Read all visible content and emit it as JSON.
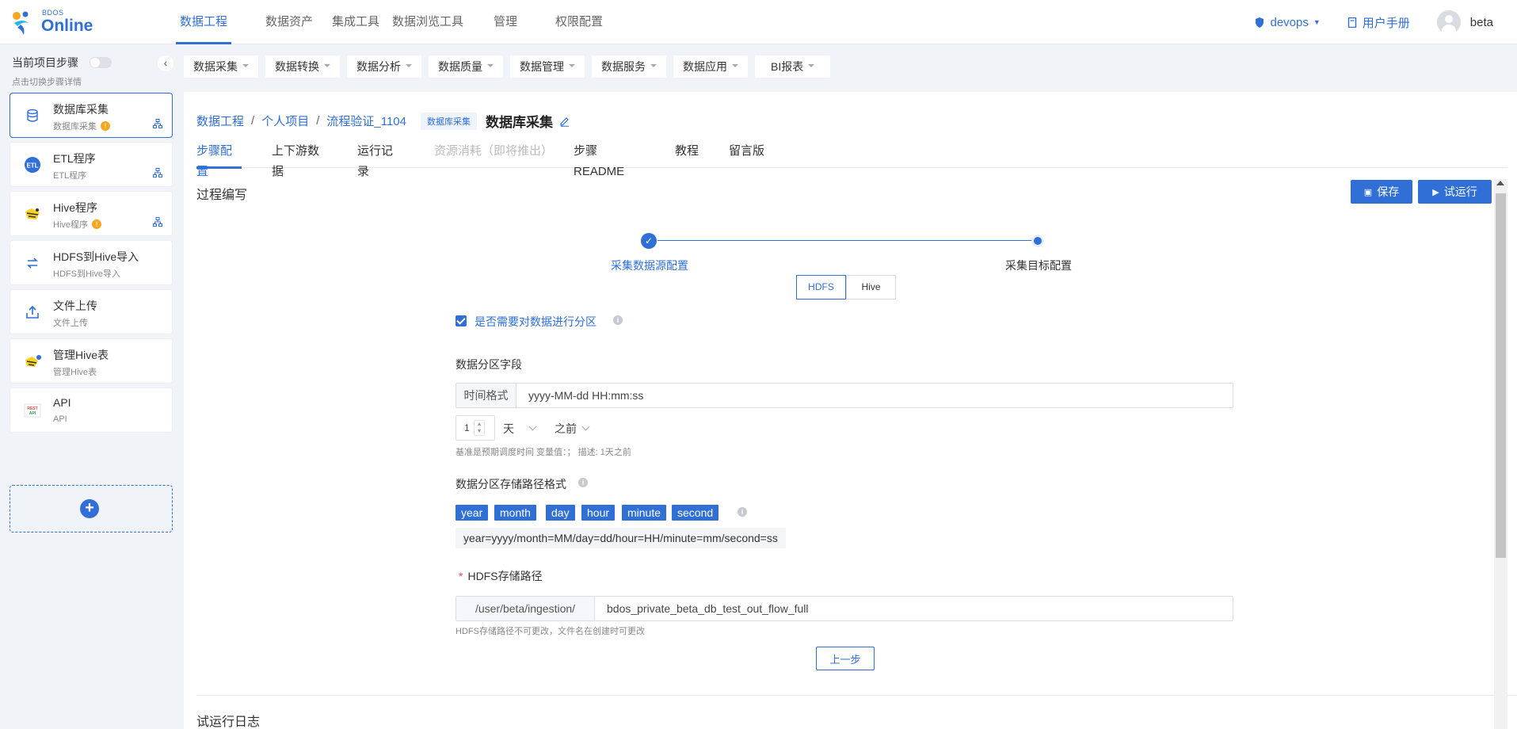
{
  "logo": {
    "small": "BDOS",
    "big": "Online"
  },
  "nav": [
    {
      "label": "数据工程",
      "active": true
    },
    {
      "label": "数据资产"
    },
    {
      "label": "集成工具"
    },
    {
      "label": "数据浏览工具"
    },
    {
      "label": "管理"
    },
    {
      "label": "权限配置"
    }
  ],
  "top_right": {
    "project": "devops",
    "manual": "用户手册",
    "user": "beta"
  },
  "sidebar": {
    "header": "当前项目步骤",
    "subheader": "点击切换步骤详情",
    "collapse_glyph": "‹",
    "items": [
      {
        "title": "数据库采集",
        "sub": "数据库采集",
        "warn": true,
        "tree": true,
        "icon": "database-icon"
      },
      {
        "title": "ETL程序",
        "sub": "ETL程序",
        "warn": false,
        "tree": true,
        "icon": "etl-icon"
      },
      {
        "title": "Hive程序",
        "sub": "Hive程序",
        "warn": true,
        "tree": true,
        "icon": "hive-icon"
      },
      {
        "title": "HDFS到Hive导入",
        "sub": "HDFS到Hive导入",
        "warn": false,
        "tree": false,
        "icon": "transfer-icon"
      },
      {
        "title": "文件上传",
        "sub": "文件上传",
        "warn": false,
        "tree": false,
        "icon": "upload-icon"
      },
      {
        "title": "管理Hive表",
        "sub": "管理Hive表",
        "warn": false,
        "tree": false,
        "icon": "hive-table-icon"
      },
      {
        "title": "API",
        "sub": "API",
        "warn": false,
        "tree": false,
        "icon": "rest-api-icon"
      }
    ],
    "add_glyph": "+"
  },
  "categories": [
    "数据采集",
    "数据转换",
    "数据分析",
    "数据质量",
    "数据管理",
    "数据服务",
    "数据应用",
    "BI报表"
  ],
  "breadcrumb": {
    "items": [
      "数据工程",
      "个人项目",
      "流程验证_1104"
    ],
    "sep": "/",
    "tag": "数据库采集",
    "title": "数据库采集"
  },
  "tabs": [
    {
      "label": "步骤配置",
      "active": true
    },
    {
      "label": "上下游数据"
    },
    {
      "label": "运行记录"
    },
    {
      "label": "资源消耗（即将推出）",
      "disabled": true
    },
    {
      "label": "步骤README"
    },
    {
      "label": "教程"
    },
    {
      "label": "留言版"
    }
  ],
  "section_title": "过程编写",
  "buttons": {
    "save": "保存",
    "trial_run": "试运行",
    "prev": "上一步"
  },
  "steps": {
    "step1": "采集数据源配置",
    "step2": "采集目标配置"
  },
  "segment": {
    "options": [
      "HDFS",
      "Hive"
    ],
    "selected": "HDFS"
  },
  "partition": {
    "checkbox_label": "是否需要对数据进行分区",
    "checked": true,
    "field_label": "数据分区字段",
    "time_format_addon": "时间格式",
    "time_format_value": "yyyy-MM-dd HH:mm:ss",
    "offset_value": "1",
    "unit": "天",
    "direction": "之前",
    "hint": "基准是预期调度时间 变量值：；  描述: 1天之前",
    "path_format_label": "数据分区存储路径格式",
    "chips": [
      "year",
      "month",
      "day",
      "hour",
      "minute",
      "second"
    ],
    "path_pattern": "year=yyyy/month=MM/day=dd/hour=HH/minute=mm/second=ss"
  },
  "hdfs": {
    "label": "HDFS存储路径",
    "required_mark": "*",
    "prefix": "/user/beta/ingestion/",
    "value": "bdos_private_beta_db_test_out_flow_full",
    "hint": "HDFS存储路径不可更改，文件名在创建时可更改"
  },
  "log_title": "试运行日志",
  "colors": {
    "primary": "#2f6fd6",
    "warning": "#f5a623",
    "required": "#e5484d"
  }
}
